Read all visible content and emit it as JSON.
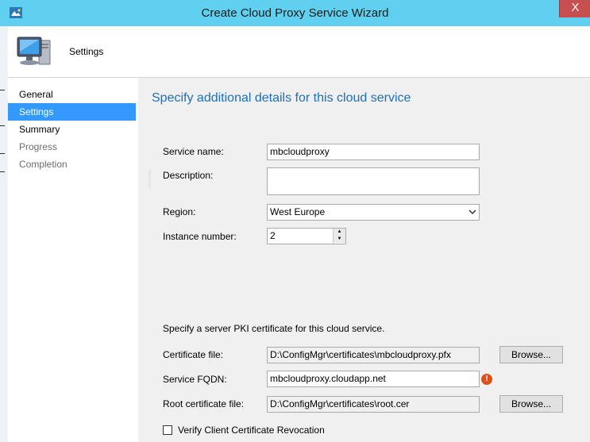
{
  "window": {
    "title": "Create Cloud Proxy Service Wizard",
    "close_symbol": "X",
    "app_icon": "wizard-app-icon"
  },
  "header": {
    "icon": "computer-monitor-icon",
    "title": "Settings"
  },
  "nav": {
    "items": [
      {
        "label": "General",
        "state": "normal"
      },
      {
        "label": "Settings",
        "state": "selected"
      },
      {
        "label": "Summary",
        "state": "normal"
      },
      {
        "label": "Progress",
        "state": "disabled"
      },
      {
        "label": "Completion",
        "state": "disabled"
      }
    ]
  },
  "content": {
    "heading": "Specify additional details for this cloud service",
    "service_name": {
      "label": "Service name:",
      "value": "mbcloudproxy"
    },
    "description": {
      "label": "Description:",
      "value": ""
    },
    "region": {
      "label": "Region:",
      "value": "West Europe"
    },
    "instance_number": {
      "label": "Instance number:",
      "value": "2"
    },
    "pki_text": "Specify a server PKI certificate for this cloud service.",
    "certificate_file": {
      "label": "Certificate file:",
      "value": "D:\\ConfigMgr\\certificates\\mbcloudproxy.pfx",
      "button": "Browse..."
    },
    "service_fqdn": {
      "label": "Service FQDN:",
      "value": "mbcloudproxy.cloudapp.net",
      "warning_symbol": "!"
    },
    "root_certificate": {
      "label": "Root certificate file:",
      "value": "D:\\ConfigMgr\\certificates\\root.cer",
      "button": "Browse..."
    },
    "verify_revocation": {
      "label": "Verify Client Certificate Revocation",
      "checked": false
    }
  },
  "colors": {
    "titlebar": "#5fd0f0",
    "close": "#c74f50",
    "nav_selected": "#3399ff",
    "heading": "#1f6fb8",
    "warning": "#d9521c"
  }
}
